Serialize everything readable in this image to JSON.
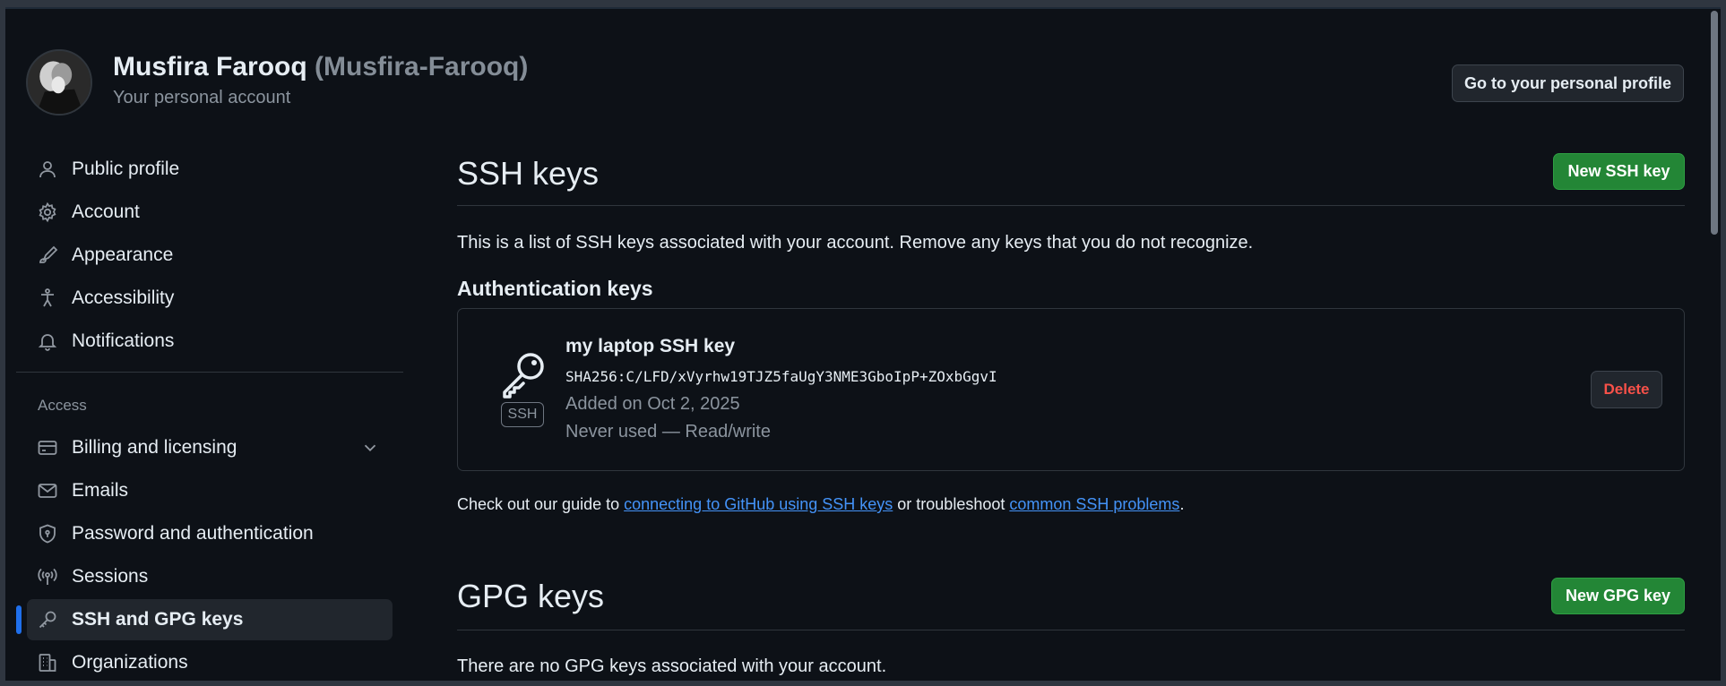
{
  "header": {
    "name": "Musfira Farooq",
    "login": "(Musfira-Farooq)",
    "subtitle": "Your personal account",
    "profile_button": "Go to your personal profile"
  },
  "sidebar": {
    "items": [
      {
        "label": "Public profile",
        "icon": "person-icon"
      },
      {
        "label": "Account",
        "icon": "gear-icon"
      },
      {
        "label": "Appearance",
        "icon": "paintbrush-icon"
      },
      {
        "label": "Accessibility",
        "icon": "accessibility-icon"
      },
      {
        "label": "Notifications",
        "icon": "bell-icon"
      }
    ],
    "access_heading": "Access",
    "access_items": [
      {
        "label": "Billing and licensing",
        "icon": "credit-card-icon"
      },
      {
        "label": "Emails",
        "icon": "mail-icon"
      },
      {
        "label": "Password and authentication",
        "icon": "shield-lock-icon"
      },
      {
        "label": "Sessions",
        "icon": "broadcast-icon"
      },
      {
        "label": "SSH and GPG keys",
        "icon": "key-icon",
        "active": true
      },
      {
        "label": "Organizations",
        "icon": "organization-icon"
      }
    ]
  },
  "ssh": {
    "title": "SSH keys",
    "new_button": "New SSH key",
    "description": "This is a list of SSH keys associated with your account. Remove any keys that you do not recognize.",
    "auth_heading": "Authentication keys",
    "key": {
      "badge": "SSH",
      "title": "my laptop SSH key",
      "fingerprint": "SHA256:C/LFD/xVyrhw19TJZ5faUgY3NME3GboIpP+ZOxbGgvI",
      "added": "Added on Oct 2, 2025",
      "usage": "Never used — Read/write",
      "delete_button": "Delete"
    },
    "guide": {
      "prefix": "Check out our guide to ",
      "link1": "connecting to GitHub using SSH keys",
      "middle": " or troubleshoot ",
      "link2": "common SSH problems",
      "suffix": "."
    }
  },
  "gpg": {
    "title": "GPG keys",
    "new_button": "New GPG key",
    "description": "There are no GPG keys associated with your account."
  },
  "colors": {
    "background": "#0d1117",
    "accent_green": "#238636",
    "link": "#4493f8",
    "danger": "#f85149",
    "active_indicator": "#1f6feb"
  }
}
